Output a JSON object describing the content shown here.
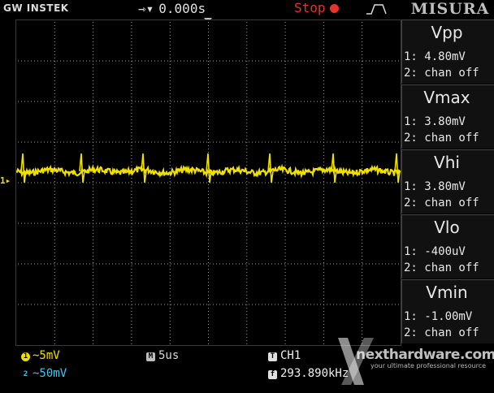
{
  "header": {
    "brand": "GW INSTEK",
    "trigger_glyph": "⇾",
    "trigger_arrow": "▾",
    "trigger_delay": "0.000s",
    "run_state": "Stop",
    "measure_title": "MISURA"
  },
  "channel_marker": "1",
  "measurements": [
    {
      "name": "Vpp",
      "ch1": "1: 4.80mV",
      "ch2": "2: chan off"
    },
    {
      "name": "Vmax",
      "ch1": "1: 3.80mV",
      "ch2": "2: chan off"
    },
    {
      "name": "Vhi",
      "ch1": "1: 3.80mV",
      "ch2": "2: chan off"
    },
    {
      "name": "Vlo",
      "ch1": "1: -400uV",
      "ch2": "2: chan off"
    },
    {
      "name": "Vmin",
      "ch1": "1: -1.00mV",
      "ch2": "2: chan off"
    }
  ],
  "bottom": {
    "ch1_badge": "1",
    "ch1_scale": "~5mV",
    "ch2_badge": "2",
    "ch2_scale": "~50mV",
    "timebase_badge": "M",
    "timebase": "5us",
    "trigger_badge": "T",
    "trigger_source": "CH1",
    "freq_badge": "f",
    "frequency": "293.890kHz"
  },
  "watermark": {
    "text": "nexthardware.com",
    "tagline": "your ultimate professional resource"
  },
  "colors": {
    "ch1": "#f0e000",
    "ch2": "#3ec6ee",
    "stop": "#e8322c",
    "grid": "#9a9a9a"
  }
}
